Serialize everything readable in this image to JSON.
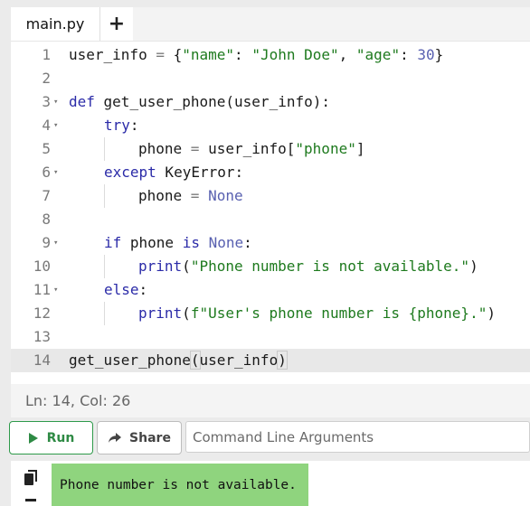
{
  "tabs": {
    "file_label": "main.py",
    "add_label": "+"
  },
  "editor": {
    "lines": [
      {
        "n": "1",
        "fold": ""
      },
      {
        "n": "2",
        "fold": ""
      },
      {
        "n": "3",
        "fold": "▾"
      },
      {
        "n": "4",
        "fold": "▾"
      },
      {
        "n": "5",
        "fold": ""
      },
      {
        "n": "6",
        "fold": "▾"
      },
      {
        "n": "7",
        "fold": ""
      },
      {
        "n": "8",
        "fold": ""
      },
      {
        "n": "9",
        "fold": "▾"
      },
      {
        "n": "10",
        "fold": ""
      },
      {
        "n": "11",
        "fold": "▾"
      },
      {
        "n": "12",
        "fold": ""
      },
      {
        "n": "13",
        "fold": ""
      },
      {
        "n": "14",
        "fold": ""
      }
    ],
    "tokens": {
      "l1": [
        "user_info",
        " = ",
        "{",
        "\"name\"",
        ": ",
        "\"John Doe\"",
        ", ",
        "\"age\"",
        ": ",
        "30",
        "}"
      ],
      "l3": [
        "def",
        " get_user_phone(user_info):"
      ],
      "l4": [
        "try",
        ":"
      ],
      "l5": [
        "phone",
        " = ",
        "user_info[",
        "\"phone\"",
        "]"
      ],
      "l6": [
        "except",
        " KeyError:"
      ],
      "l7": [
        "phone",
        " = ",
        "None"
      ],
      "l9": [
        "if",
        " phone ",
        "is",
        " ",
        "None",
        ":"
      ],
      "l10": [
        "print",
        "(",
        "\"Phone number is not available.\"",
        ")"
      ],
      "l11": [
        "else",
        ":"
      ],
      "l12": [
        "print",
        "(",
        "f\"User's phone number is {phone}.\"",
        ")"
      ],
      "l14": [
        "get_user_phone",
        "(",
        "user_info",
        ")"
      ]
    }
  },
  "status": {
    "position": "Ln: 14,  Col: 26"
  },
  "toolbar": {
    "run_label": "Run",
    "share_label": "Share",
    "args_placeholder": "Command Line Arguments"
  },
  "output": {
    "text": "Phone number is not available."
  },
  "colors": {
    "run_accent": "#2e8a44",
    "output_bg": "#8fd47e"
  }
}
